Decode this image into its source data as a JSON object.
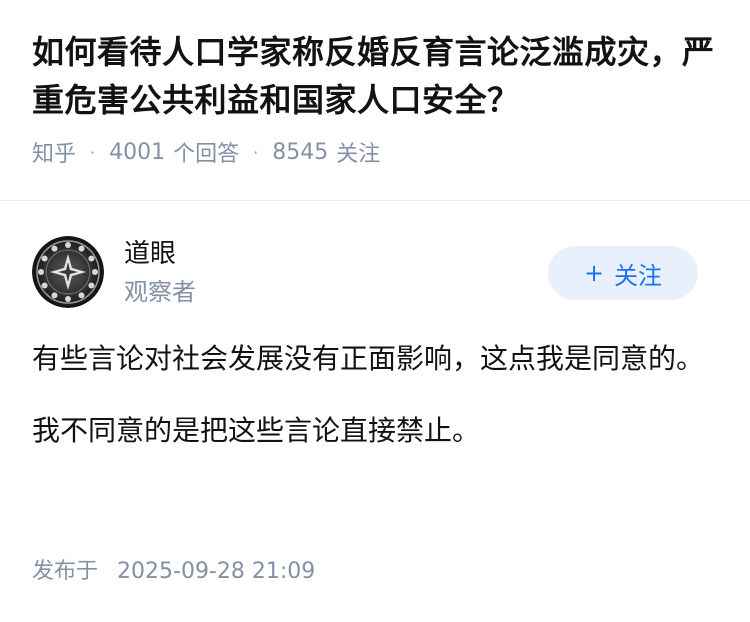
{
  "question": {
    "title": "如何看待人口学家称反婚反育言论泛滥成灾，严重危害公共利益和国家人口安全？",
    "source": "知乎",
    "answers_count": "4001",
    "answers_label": "个回答",
    "followers_count": "8545",
    "followers_label": "关注"
  },
  "author": {
    "name": "道眼",
    "role": "观察者",
    "follow_label": "关注",
    "follow_icon": "plus-icon"
  },
  "answer": {
    "paragraphs": [
      "有些言论对社会发展没有正面影响，这点我是同意的。",
      "我不同意的是把这些言论直接禁止。"
    ]
  },
  "publish": {
    "label": "发布于",
    "datetime": "2025-09-28 21:09"
  }
}
